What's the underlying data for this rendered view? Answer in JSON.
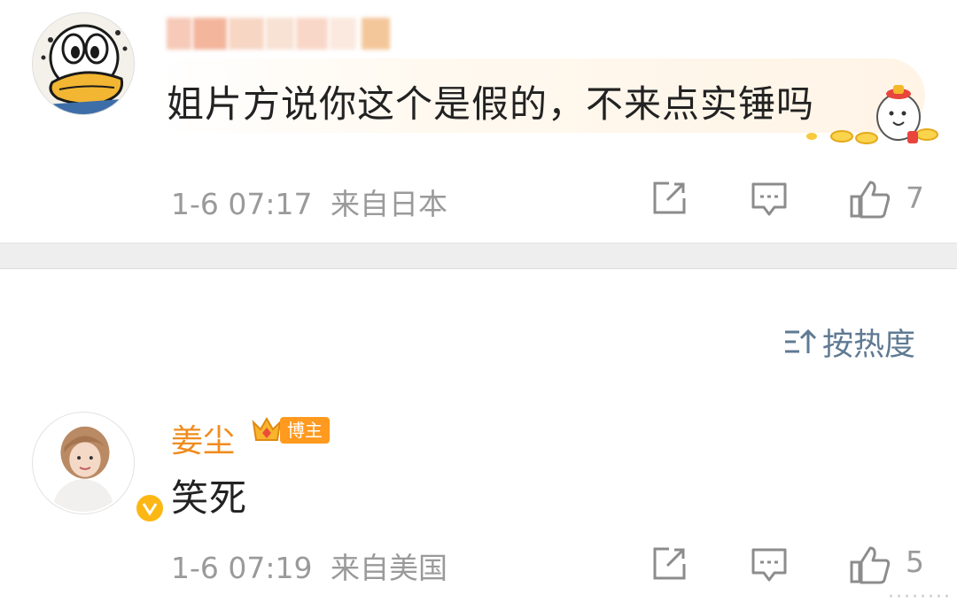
{
  "comments": [
    {
      "username": "",
      "text": "姐片方说你这个是假的，不来点实锤吗",
      "time": "1-6 07:17",
      "source": "来自日本",
      "likes": "7",
      "share_icon": "share-icon",
      "reply_icon": "comment-icon",
      "like_icon": "thumbs-up-icon"
    },
    {
      "username": "姜尘",
      "badge": "博主",
      "text": "笑死",
      "time": "1-6 07:19",
      "source": "来自美国",
      "likes": "5",
      "verified": true
    }
  ],
  "sort": {
    "label": "按热度",
    "icon": "sort-icon"
  },
  "watermark": "········",
  "colors": {
    "meta": "#9a9a9a",
    "name": "#f08c1e",
    "sort": "#5f7a93",
    "badge": "#ff9a1f",
    "verified": "#fcb714"
  }
}
